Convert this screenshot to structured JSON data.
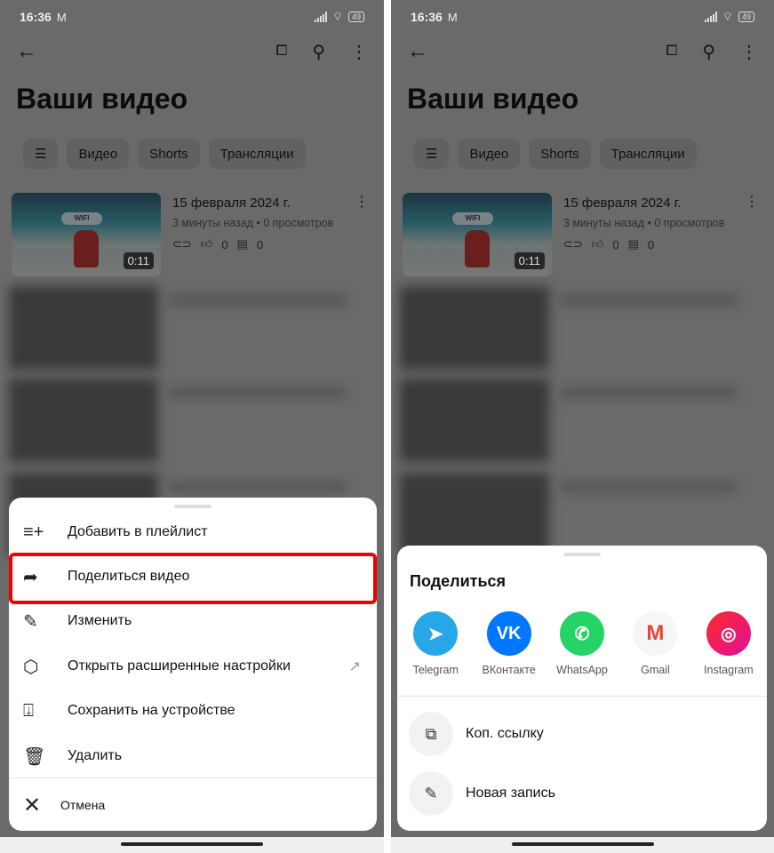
{
  "status": {
    "time": "16:36",
    "mail_icon": "gmail-notification-icon",
    "battery": "49"
  },
  "header": {
    "title": "Ваши видео",
    "chips": [
      "Видео",
      "Shorts",
      "Трансляции"
    ]
  },
  "video": {
    "date": "15 февраля 2024 г.",
    "meta": "3 минуты назад • 0 просмотров",
    "likes": "0",
    "comments": "0",
    "duration": "0:11",
    "logo": "WIFI"
  },
  "menu": {
    "items": [
      {
        "icon": "add-to-playlist-icon",
        "label": "Добавить в плейлист"
      },
      {
        "icon": "share-icon",
        "label": "Поделиться видео",
        "highlighted": true
      },
      {
        "icon": "pencil-icon",
        "label": "Изменить"
      },
      {
        "icon": "advanced-settings-icon",
        "label": "Открыть расширенные настройки",
        "external": true
      },
      {
        "icon": "download-icon",
        "label": "Сохранить на устройстве"
      },
      {
        "icon": "trash-icon",
        "label": "Удалить"
      }
    ],
    "cancel": "Отмена",
    "highlight_color": "#f20000"
  },
  "share": {
    "title": "Поделиться",
    "apps": [
      {
        "label": "Telegram",
        "color": "#27a7e7"
      },
      {
        "label": "ВКонтакте",
        "color": "#0077ff"
      },
      {
        "label": "WhatsApp",
        "color": "#25d366"
      },
      {
        "label": "Gmail",
        "color": "#f6f6f6"
      },
      {
        "label": "Instagram",
        "color": "#f0126a"
      }
    ],
    "actions": [
      {
        "icon": "copy-icon",
        "label": "Коп. ссылку"
      },
      {
        "icon": "edit-post-icon",
        "label": "Новая запись"
      }
    ]
  }
}
